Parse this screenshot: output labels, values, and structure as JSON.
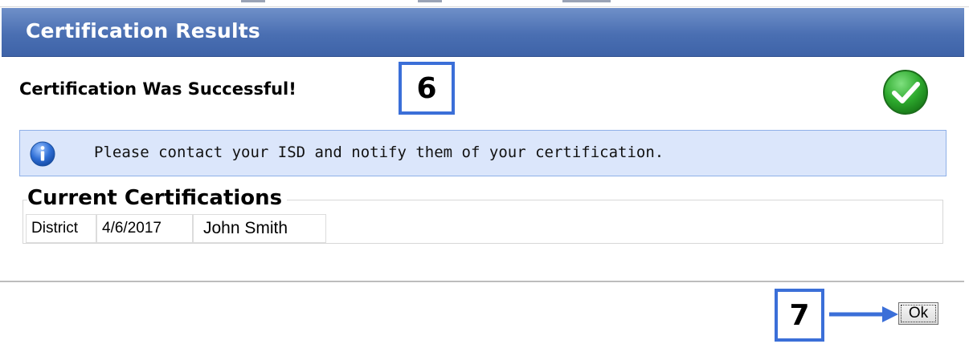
{
  "dialog": {
    "title": "Certification Results",
    "result_message": "Certification Was Successful!",
    "status_icon": "check-circle-icon",
    "status_color": "#2eaa2e"
  },
  "info": {
    "icon": "info-icon",
    "message": "Please contact your ISD and notify them of your certification."
  },
  "current_certifications": {
    "legend": "Current Certifications",
    "rows": [
      {
        "type": "District",
        "date": "4/6/2017",
        "name": "John Smith"
      }
    ]
  },
  "steps": {
    "step_6": "6",
    "step_7": "7"
  },
  "footer": {
    "ok_label": "Ok"
  },
  "colors": {
    "header_blue": "#4a6fb2",
    "annotation_blue": "#3b6fd8",
    "info_background": "#dbe6fb"
  }
}
